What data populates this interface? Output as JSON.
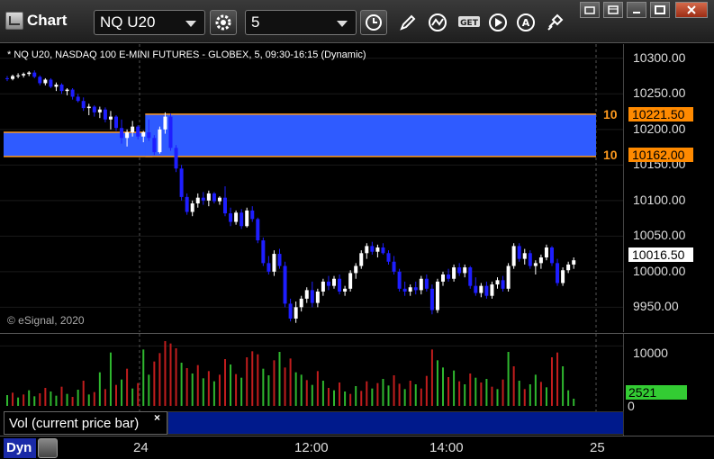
{
  "window": {
    "title": "Chart",
    "symbol": "NQ U20",
    "interval": "5"
  },
  "colors": {
    "up_candle": "#ffffff",
    "down_candle": "#1e1eff",
    "zone_fill": "#2f5bff",
    "zone_border": "#ff9a1e",
    "vol_up": "#2fb82f",
    "vol_down": "#c21d1d",
    "last_price_tag": "#ffffff",
    "level_tag": "#ff8a00",
    "vol_tag": "#33cc33"
  },
  "icons": {
    "settings": "gear-icon",
    "time": "clock-icon",
    "draw": "pencil-icon",
    "studies": "line-chart-icon",
    "get": "get-icon",
    "play": "play-icon",
    "alert": "alert-a-icon",
    "link": "link-icon"
  },
  "price_pane": {
    "header": "* NQ U20, NASDAQ 100 E-MINI FUTURES - GLOBEX, 5, 09:30-16:15 (Dynamic)",
    "copyright": "© eSignal, 2020",
    "ticks": [
      "10300.00",
      "10250.00",
      "10200.00",
      "10150.00",
      "10100.00",
      "10050.00",
      "10000.00",
      "9950.00"
    ],
    "last_price": "10016.50",
    "levels": [
      {
        "label": "10",
        "price": "10221.50"
      },
      {
        "label": "10",
        "price": "10162.00"
      }
    ]
  },
  "volume_pane": {
    "label": "Vol (current price bar)",
    "close_symbol": "×",
    "ticks": [
      "10000",
      "0"
    ],
    "last_volume": "2521"
  },
  "time_axis": {
    "ticks": [
      "24",
      "12:00",
      "14:00",
      "25"
    ],
    "mode_label": "Dyn"
  },
  "chart_data": {
    "type": "candlestick",
    "ylim": [
      9915,
      10320
    ],
    "zones": [
      {
        "top": 10196,
        "bottom": 10162,
        "start": 0,
        "end": 27
      },
      {
        "top": 10221.5,
        "bottom": 10162,
        "start": 26,
        "end": 116
      }
    ],
    "candles": [
      [
        10272,
        10275,
        10268,
        10271
      ],
      [
        10271,
        10277,
        10269,
        10275
      ],
      [
        10275,
        10279,
        10272,
        10276
      ],
      [
        10276,
        10280,
        10273,
        10278
      ],
      [
        10278,
        10282,
        10275,
        10280
      ],
      [
        10280,
        10283,
        10272,
        10274
      ],
      [
        10274,
        10276,
        10262,
        10265
      ],
      [
        10265,
        10272,
        10262,
        10270
      ],
      [
        10270,
        10272,
        10258,
        10260
      ],
      [
        10260,
        10266,
        10254,
        10263
      ],
      [
        10263,
        10265,
        10250,
        10254
      ],
      [
        10254,
        10258,
        10248,
        10256
      ],
      [
        10256,
        10258,
        10242,
        10246
      ],
      [
        10246,
        10250,
        10238,
        10240
      ],
      [
        10240,
        10245,
        10226,
        10230
      ],
      [
        10230,
        10236,
        10220,
        10232
      ],
      [
        10232,
        10234,
        10218,
        10224
      ],
      [
        10224,
        10232,
        10216,
        10228
      ],
      [
        10228,
        10231,
        10210,
        10214
      ],
      [
        10214,
        10226,
        10200,
        10218
      ],
      [
        10218,
        10220,
        10198,
        10202
      ],
      [
        10202,
        10214,
        10180,
        10188
      ],
      [
        10188,
        10200,
        10176,
        10196
      ],
      [
        10196,
        10212,
        10190,
        10204
      ],
      [
        10204,
        10206,
        10186,
        10190
      ],
      [
        10190,
        10198,
        10182,
        10196
      ],
      [
        10196,
        10214,
        10184,
        10188
      ],
      [
        10188,
        10192,
        10164,
        10168
      ],
      [
        10168,
        10204,
        10166,
        10200
      ],
      [
        10200,
        10224,
        10194,
        10218
      ],
      [
        10218,
        10222,
        10170,
        10174
      ],
      [
        10174,
        10178,
        10140,
        10145
      ],
      [
        10145,
        10150,
        10100,
        10105
      ],
      [
        10105,
        10110,
        10080,
        10084
      ],
      [
        10084,
        10100,
        10078,
        10096
      ],
      [
        10096,
        10110,
        10090,
        10104
      ],
      [
        10104,
        10112,
        10094,
        10100
      ],
      [
        10100,
        10114,
        10092,
        10110
      ],
      [
        10110,
        10112,
        10096,
        10099
      ],
      [
        10099,
        10106,
        10094,
        10104
      ],
      [
        10104,
        10120,
        10078,
        10082
      ],
      [
        10082,
        10090,
        10064,
        10070
      ],
      [
        10070,
        10086,
        10066,
        10083
      ],
      [
        10083,
        10088,
        10060,
        10064
      ],
      [
        10064,
        10090,
        10062,
        10086
      ],
      [
        10086,
        10092,
        10070,
        10074
      ],
      [
        10074,
        10076,
        10040,
        10044
      ],
      [
        10044,
        10048,
        10008,
        10012
      ],
      [
        10012,
        10022,
        9996,
        10000
      ],
      [
        10000,
        10030,
        9994,
        10025
      ],
      [
        10025,
        10032,
        10004,
        10008
      ],
      [
        10008,
        10014,
        9950,
        9955
      ],
      [
        9955,
        9962,
        9930,
        9934
      ],
      [
        9934,
        9958,
        9928,
        9950
      ],
      [
        9950,
        9966,
        9944,
        9962
      ],
      [
        9962,
        9978,
        9956,
        9974
      ],
      [
        9974,
        9986,
        9950,
        9956
      ],
      [
        9956,
        9976,
        9950,
        9972
      ],
      [
        9972,
        9990,
        9966,
        9986
      ],
      [
        9986,
        9994,
        9974,
        9980
      ],
      [
        9980,
        9994,
        9976,
        9990
      ],
      [
        9990,
        9996,
        9968,
        9972
      ],
      [
        9972,
        9980,
        9966,
        9976
      ],
      [
        9976,
        10002,
        9972,
        9998
      ],
      [
        9998,
        10012,
        9990,
        10008
      ],
      [
        10008,
        10030,
        10004,
        10026
      ],
      [
        10026,
        10040,
        10018,
        10036
      ],
      [
        10036,
        10042,
        10024,
        10028
      ],
      [
        10028,
        10038,
        10020,
        10034
      ],
      [
        10034,
        10040,
        10024,
        10026
      ],
      [
        10026,
        10030,
        10010,
        10014
      ],
      [
        10014,
        10022,
        9996,
        10000
      ],
      [
        10000,
        10004,
        9972,
        9976
      ],
      [
        9976,
        9986,
        9966,
        9972
      ],
      [
        9972,
        9982,
        9966,
        9978
      ],
      [
        9978,
        9986,
        9968,
        9974
      ],
      [
        9974,
        9994,
        9968,
        9990
      ],
      [
        9990,
        9996,
        9972,
        9976
      ],
      [
        9976,
        9982,
        9940,
        9946
      ],
      [
        9946,
        9990,
        9942,
        9986
      ],
      [
        9986,
        10000,
        9980,
        9996
      ],
      [
        9996,
        10004,
        9986,
        9990
      ],
      [
        9990,
        10010,
        9986,
        10006
      ],
      [
        10006,
        10012,
        9994,
        9998
      ],
      [
        9998,
        10010,
        9992,
        10006
      ],
      [
        10006,
        10008,
        9976,
        9980
      ],
      [
        9980,
        9992,
        9966,
        9970
      ],
      [
        9970,
        9984,
        9964,
        9980
      ],
      [
        9980,
        9986,
        9962,
        9966
      ],
      [
        9966,
        9986,
        9962,
        9982
      ],
      [
        9982,
        9992,
        9976,
        9988
      ],
      [
        9988,
        9994,
        9972,
        9976
      ],
      [
        9976,
        10012,
        9972,
        10008
      ],
      [
        10008,
        10040,
        10004,
        10036
      ],
      [
        10036,
        10040,
        10014,
        10018
      ],
      [
        10018,
        10032,
        10010,
        10026
      ],
      [
        10026,
        10030,
        10004,
        10008
      ],
      [
        10008,
        10016,
        9996,
        10012
      ],
      [
        10012,
        10024,
        10004,
        10020
      ],
      [
        10020,
        10038,
        10016,
        10034
      ],
      [
        10034,
        10036,
        10008,
        10012
      ],
      [
        10012,
        10018,
        9980,
        9984
      ],
      [
        9984,
        10006,
        9980,
        10002
      ],
      [
        10002,
        10014,
        9998,
        10010
      ],
      [
        10010,
        10020,
        10004,
        10016
      ]
    ],
    "volume": [
      [
        1800,
        "u"
      ],
      [
        2200,
        "d"
      ],
      [
        1400,
        "u"
      ],
      [
        1900,
        "d"
      ],
      [
        2600,
        "u"
      ],
      [
        1600,
        "u"
      ],
      [
        2100,
        "d"
      ],
      [
        3000,
        "d"
      ],
      [
        2400,
        "u"
      ],
      [
        1700,
        "u"
      ],
      [
        3200,
        "d"
      ],
      [
        2000,
        "u"
      ],
      [
        1500,
        "d"
      ],
      [
        2700,
        "u"
      ],
      [
        4200,
        "d"
      ],
      [
        1900,
        "u"
      ],
      [
        2300,
        "d"
      ],
      [
        5600,
        "u"
      ],
      [
        2800,
        "d"
      ],
      [
        8900,
        "u"
      ],
      [
        3500,
        "d"
      ],
      [
        4400,
        "u"
      ],
      [
        6200,
        "d"
      ],
      [
        2900,
        "u"
      ],
      [
        3800,
        "d"
      ],
      [
        9400,
        "u"
      ],
      [
        5200,
        "u"
      ],
      [
        7400,
        "d"
      ],
      [
        8800,
        "d"
      ],
      [
        10800,
        "d"
      ],
      [
        10400,
        "d"
      ],
      [
        9600,
        "d"
      ],
      [
        7200,
        "u"
      ],
      [
        6300,
        "d"
      ],
      [
        5400,
        "u"
      ],
      [
        6800,
        "d"
      ],
      [
        4600,
        "u"
      ],
      [
        5800,
        "d"
      ],
      [
        4100,
        "u"
      ],
      [
        5200,
        "d"
      ],
      [
        7800,
        "d"
      ],
      [
        6900,
        "u"
      ],
      [
        5300,
        "d"
      ],
      [
        4700,
        "u"
      ],
      [
        8100,
        "d"
      ],
      [
        9100,
        "d"
      ],
      [
        8600,
        "d"
      ],
      [
        6200,
        "u"
      ],
      [
        5100,
        "u"
      ],
      [
        7600,
        "d"
      ],
      [
        9000,
        "u"
      ],
      [
        6400,
        "d"
      ],
      [
        7900,
        "d"
      ],
      [
        5600,
        "u"
      ],
      [
        5200,
        "u"
      ],
      [
        4300,
        "d"
      ],
      [
        3500,
        "u"
      ],
      [
        5800,
        "d"
      ],
      [
        4200,
        "u"
      ],
      [
        3000,
        "d"
      ],
      [
        2600,
        "u"
      ],
      [
        3900,
        "d"
      ],
      [
        2400,
        "u"
      ],
      [
        2000,
        "d"
      ],
      [
        3300,
        "u"
      ],
      [
        2500,
        "d"
      ],
      [
        4100,
        "d"
      ],
      [
        2900,
        "u"
      ],
      [
        3800,
        "d"
      ],
      [
        4500,
        "u"
      ],
      [
        3400,
        "u"
      ],
      [
        5100,
        "d"
      ],
      [
        3700,
        "d"
      ],
      [
        2800,
        "u"
      ],
      [
        4200,
        "d"
      ],
      [
        3600,
        "u"
      ],
      [
        2900,
        "d"
      ],
      [
        5000,
        "d"
      ],
      [
        9400,
        "d"
      ],
      [
        7600,
        "u"
      ],
      [
        6400,
        "u"
      ],
      [
        4800,
        "d"
      ],
      [
        5900,
        "u"
      ],
      [
        4100,
        "d"
      ],
      [
        3600,
        "u"
      ],
      [
        5400,
        "d"
      ],
      [
        4700,
        "u"
      ],
      [
        3900,
        "d"
      ],
      [
        4500,
        "u"
      ],
      [
        3200,
        "d"
      ],
      [
        2800,
        "u"
      ],
      [
        4400,
        "d"
      ],
      [
        9000,
        "u"
      ],
      [
        6600,
        "d"
      ],
      [
        4200,
        "u"
      ],
      [
        2800,
        "d"
      ],
      [
        3600,
        "u"
      ],
      [
        5200,
        "u"
      ],
      [
        4000,
        "d"
      ],
      [
        3100,
        "u"
      ],
      [
        8100,
        "d"
      ],
      [
        8900,
        "d"
      ],
      [
        6600,
        "u"
      ],
      [
        2600,
        "u"
      ],
      [
        1200,
        "u"
      ]
    ],
    "vol_ylim": [
      0,
      12000
    ]
  }
}
